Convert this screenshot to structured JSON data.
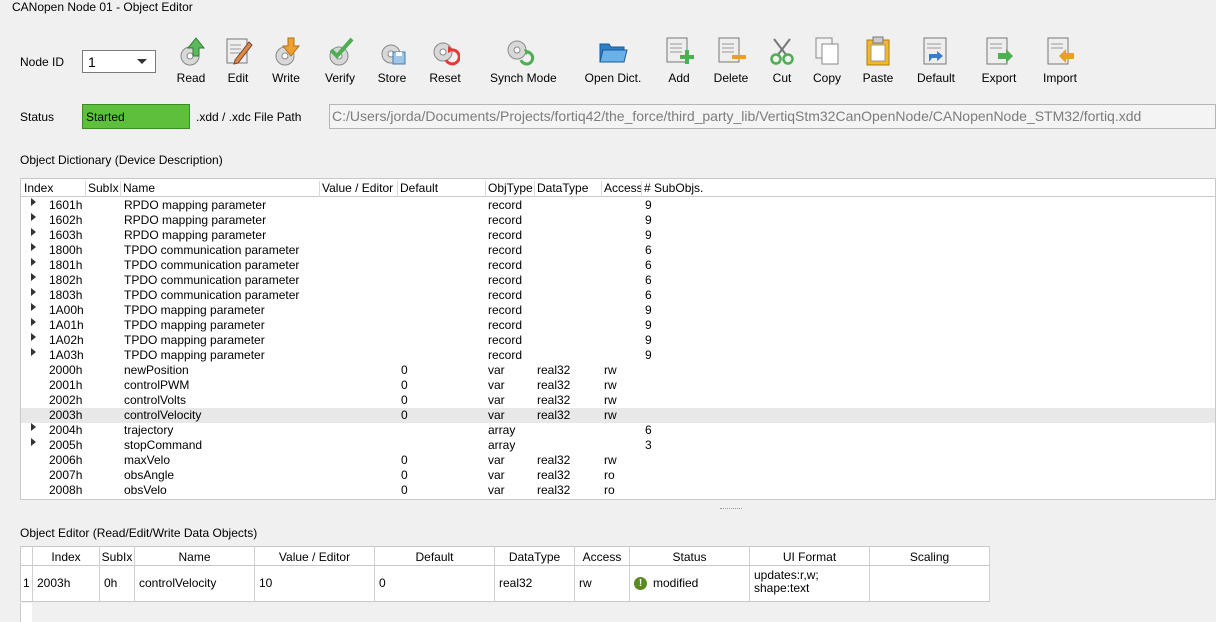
{
  "window": {
    "title": "CANopen Node 01 - Object Editor"
  },
  "node": {
    "label": "Node ID",
    "value": "1"
  },
  "toolbar": {
    "read": "Read",
    "edit": "Edit",
    "write": "Write",
    "verify": "Verify",
    "store": "Store",
    "reset": "Reset",
    "synch": "Synch Mode",
    "open": "Open Dict.",
    "add": "Add",
    "delete": "Delete",
    "cut": "Cut",
    "copy": "Copy",
    "paste": "Paste",
    "default": "Default",
    "export": "Export",
    "import": "Import"
  },
  "status": {
    "label": "Status",
    "value": "Started",
    "color": "#5dbf3c"
  },
  "file": {
    "label": ".xdd / .xdc File Path",
    "path": "C:/Users/jorda/Documents/Projects/fortiq42/the_force/third_party_lib/VertiqStm32CanOpenNode/CANopenNode_STM32/fortiq.xdd"
  },
  "dict": {
    "section_title": "Object Dictionary (Device Description)",
    "columns": [
      "Index",
      "SubIx",
      "Name",
      "Value / Editor",
      "Default",
      "ObjType",
      "DataType",
      "Access",
      "# SubObjs."
    ],
    "rows": [
      {
        "index": "1601h",
        "name": "RPDO mapping parameter",
        "default": "",
        "objtype": "record",
        "datatype": "",
        "access": "",
        "subobjs": "9",
        "expand": true
      },
      {
        "index": "1602h",
        "name": "RPDO mapping parameter",
        "default": "",
        "objtype": "record",
        "datatype": "",
        "access": "",
        "subobjs": "9",
        "expand": true
      },
      {
        "index": "1603h",
        "name": "RPDO mapping parameter",
        "default": "",
        "objtype": "record",
        "datatype": "",
        "access": "",
        "subobjs": "9",
        "expand": true
      },
      {
        "index": "1800h",
        "name": "TPDO communication parameter",
        "default": "",
        "objtype": "record",
        "datatype": "",
        "access": "",
        "subobjs": "6",
        "expand": true
      },
      {
        "index": "1801h",
        "name": "TPDO communication parameter",
        "default": "",
        "objtype": "record",
        "datatype": "",
        "access": "",
        "subobjs": "6",
        "expand": true
      },
      {
        "index": "1802h",
        "name": "TPDO communication parameter",
        "default": "",
        "objtype": "record",
        "datatype": "",
        "access": "",
        "subobjs": "6",
        "expand": true
      },
      {
        "index": "1803h",
        "name": "TPDO communication parameter",
        "default": "",
        "objtype": "record",
        "datatype": "",
        "access": "",
        "subobjs": "6",
        "expand": true
      },
      {
        "index": "1A00h",
        "name": "TPDO mapping parameter",
        "default": "",
        "objtype": "record",
        "datatype": "",
        "access": "",
        "subobjs": "9",
        "expand": true
      },
      {
        "index": "1A01h",
        "name": "TPDO mapping parameter",
        "default": "",
        "objtype": "record",
        "datatype": "",
        "access": "",
        "subobjs": "9",
        "expand": true
      },
      {
        "index": "1A02h",
        "name": "TPDO mapping parameter",
        "default": "",
        "objtype": "record",
        "datatype": "",
        "access": "",
        "subobjs": "9",
        "expand": true
      },
      {
        "index": "1A03h",
        "name": "TPDO mapping parameter",
        "default": "",
        "objtype": "record",
        "datatype": "",
        "access": "",
        "subobjs": "9",
        "expand": true
      },
      {
        "index": "2000h",
        "name": "newPosition",
        "default": "0",
        "objtype": "var",
        "datatype": "real32",
        "access": "rw",
        "subobjs": "",
        "expand": false
      },
      {
        "index": "2001h",
        "name": "controlPWM",
        "default": "0",
        "objtype": "var",
        "datatype": "real32",
        "access": "rw",
        "subobjs": "",
        "expand": false
      },
      {
        "index": "2002h",
        "name": "controlVolts",
        "default": "0",
        "objtype": "var",
        "datatype": "real32",
        "access": "rw",
        "subobjs": "",
        "expand": false
      },
      {
        "index": "2003h",
        "name": "controlVelocity",
        "default": "0",
        "objtype": "var",
        "datatype": "real32",
        "access": "rw",
        "subobjs": "",
        "expand": false,
        "selected": true
      },
      {
        "index": "2004h",
        "name": "trajectory",
        "default": "",
        "objtype": "array",
        "datatype": "",
        "access": "",
        "subobjs": "6",
        "expand": true
      },
      {
        "index": "2005h",
        "name": "stopCommand",
        "default": "",
        "objtype": "array",
        "datatype": "",
        "access": "",
        "subobjs": "3",
        "expand": true
      },
      {
        "index": "2006h",
        "name": "maxVelo",
        "default": "0",
        "objtype": "var",
        "datatype": "real32",
        "access": "rw",
        "subobjs": "",
        "expand": false
      },
      {
        "index": "2007h",
        "name": "obsAngle",
        "default": "0",
        "objtype": "var",
        "datatype": "real32",
        "access": "ro",
        "subobjs": "",
        "expand": false
      },
      {
        "index": "2008h",
        "name": "obsVelo",
        "default": "0",
        "objtype": "var",
        "datatype": "real32",
        "access": "ro",
        "subobjs": "",
        "expand": false
      }
    ]
  },
  "editor": {
    "section_title": "Object Editor (Read/Edit/Write Data Objects)",
    "columns": [
      "Index",
      "SubIx",
      "Name",
      "Value / Editor",
      "Default",
      "DataType",
      "Access",
      "Status",
      "UI Format",
      "Scaling"
    ],
    "row": {
      "num": "1",
      "index": "2003h",
      "subix": "0h",
      "name": "controlVelocity",
      "value": "10",
      "default": "0",
      "datatype": "real32",
      "access": "rw",
      "status": "modified",
      "uiformat_1": "updates:r,w;",
      "uiformat_2": "shape:text",
      "scaling": ""
    }
  }
}
